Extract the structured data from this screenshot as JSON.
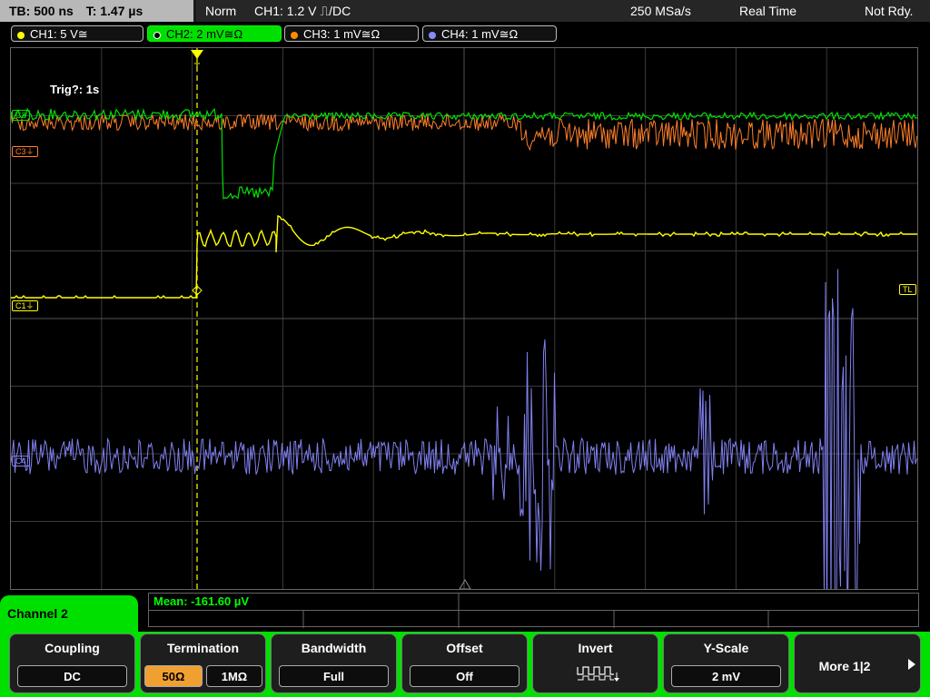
{
  "topbar": {
    "timebase": "TB: 500 ns",
    "trigger_time": "T: 1.47 µs",
    "mode": "Norm",
    "trigger_info": "CH1: 1.2 V ⎍/DC",
    "sample_rate": "250 MSa/s",
    "acq_mode": "Real Time",
    "status": "Not Rdy."
  },
  "channels": [
    {
      "label": "CH1: 5 V≅",
      "color": "#ffff00"
    },
    {
      "label": "CH2: 2 mV≅Ω",
      "color": "#00ff00"
    },
    {
      "label": "CH3: 1 mV≅Ω",
      "color": "#ff8c00"
    },
    {
      "label": "CH4: 1 mV≅Ω",
      "color": "#8a8aff"
    }
  ],
  "scope": {
    "trigger_status": "Trig?: 1s",
    "markers": {
      "c1": "C1",
      "c2": "C2",
      "c3": "C3",
      "c4": "C4",
      "tl": "TL",
      "trigger": "T"
    }
  },
  "measurement": {
    "text": "Mean: -161.60 µV"
  },
  "menu": {
    "channel_tab": "Channel 2"
  },
  "softkeys": {
    "coupling": {
      "title": "Coupling",
      "value": "DC"
    },
    "termination": {
      "title": "Termination",
      "option_a": "50Ω",
      "option_b": "1MΩ",
      "selected": "50Ω"
    },
    "bandwidth": {
      "title": "Bandwidth",
      "value": "Full"
    },
    "offset": {
      "title": "Offset",
      "value": "Off"
    },
    "invert": {
      "title": "Invert",
      "icon": "invert-waveform-icon"
    },
    "yscale": {
      "title": "Y-Scale",
      "value": "2 mV"
    },
    "more": {
      "label": "More 1|2",
      "icon": "arrow-right-icon"
    }
  },
  "colors": {
    "ch1": "#ffff00",
    "ch2": "#00ff00",
    "ch3": "#ff7f2a",
    "ch4": "#8080f0",
    "accent": "#00e000"
  }
}
